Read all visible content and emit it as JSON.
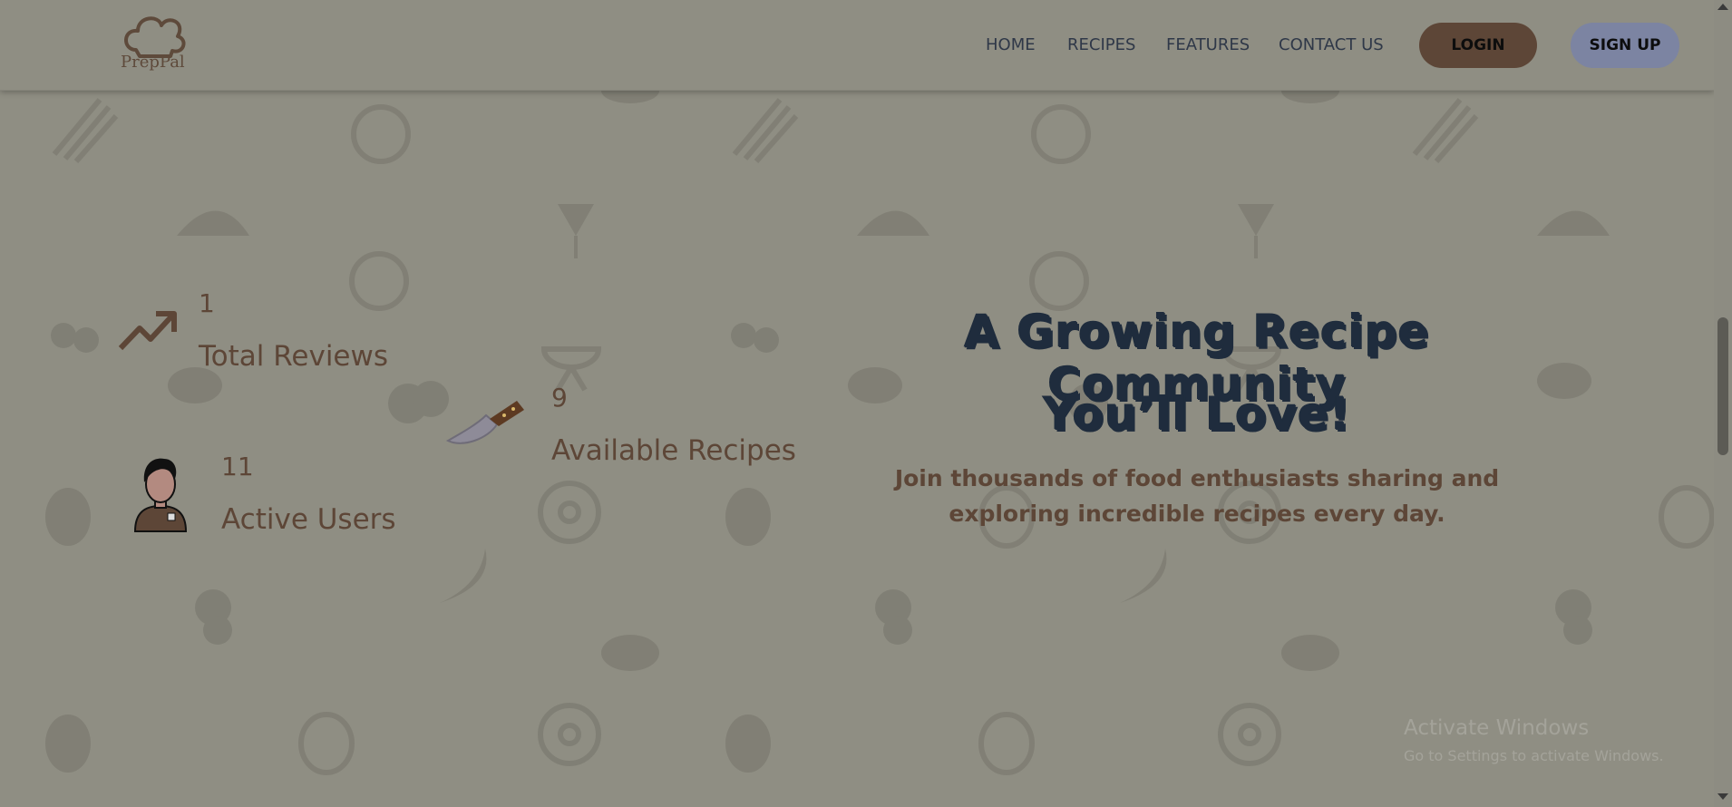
{
  "brand": {
    "name": "PrepPal"
  },
  "nav": {
    "links": [
      "HOME",
      "RECIPES",
      "FEATURES",
      "CONTACT US"
    ],
    "login_label": "LOGIN",
    "signup_label": "SIGN UP"
  },
  "stats": {
    "reviews": {
      "value": "1",
      "label": "Total Reviews"
    },
    "recipes": {
      "value": "9",
      "label": "Available Recipes"
    },
    "users": {
      "value": "11",
      "label": "Active Users"
    }
  },
  "hero": {
    "headline_line1": "A Growing Recipe Community",
    "headline_line2": "You’ll Love!",
    "subtext": "Join thousands of food enthusiasts sharing and exploring incredible recipes every day."
  },
  "watermark": {
    "title": "Activate Windows",
    "subtitle": "Go to Settings to activate Windows."
  },
  "colors": {
    "background": "#8f8e83",
    "accent_brown": "#5d4637",
    "signup_blue": "#7c84a2",
    "heading_navy": "#1f2c3d"
  }
}
